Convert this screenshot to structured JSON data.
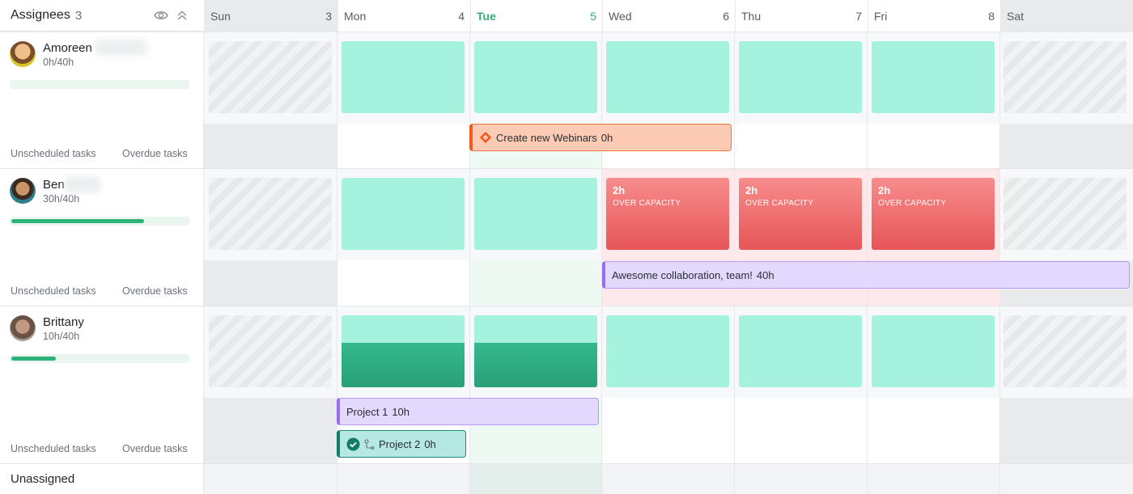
{
  "header": {
    "title": "Assignees",
    "count": "3"
  },
  "days": [
    {
      "name": "Sun",
      "num": "3"
    },
    {
      "name": "Mon",
      "num": "4"
    },
    {
      "name": "Tue",
      "num": "5"
    },
    {
      "name": "Wed",
      "num": "6"
    },
    {
      "name": "Thu",
      "num": "7"
    },
    {
      "name": "Fri",
      "num": "8"
    },
    {
      "name": "Sat",
      "num": ""
    }
  ],
  "assignees": [
    {
      "name": "Amoreen",
      "hours": "0h/40h",
      "progress": 0.0,
      "unscheduled": "Unscheduled tasks",
      "overdue": "Overdue tasks"
    },
    {
      "name": "Ben",
      "hours": "30h/40h",
      "progress": 0.75,
      "unscheduled": "Unscheduled tasks",
      "overdue": "Overdue tasks"
    },
    {
      "name": "Brittany",
      "hours": "10h/40h",
      "progress": 0.25,
      "unscheduled": "Unscheduled tasks",
      "overdue": "Overdue tasks"
    }
  ],
  "unassigned": "Unassigned",
  "over_capacity": {
    "hours": "2h",
    "label": "OVER CAPACITY"
  },
  "tasks": {
    "webinars": {
      "title": "Create new Webinars",
      "hours": "0h"
    },
    "collab": {
      "title": "Awesome collaboration, team!",
      "hours": "40h"
    },
    "project1": {
      "title": "Project 1",
      "hours": "10h"
    },
    "project2": {
      "title": "Project 2",
      "hours": "0h"
    }
  },
  "colors": {
    "accent": "#2fae79",
    "capacity": "#a5f3df",
    "over": "#e65557",
    "task_purple": "#e3d8fd",
    "task_orange": "#fdcbb3"
  }
}
